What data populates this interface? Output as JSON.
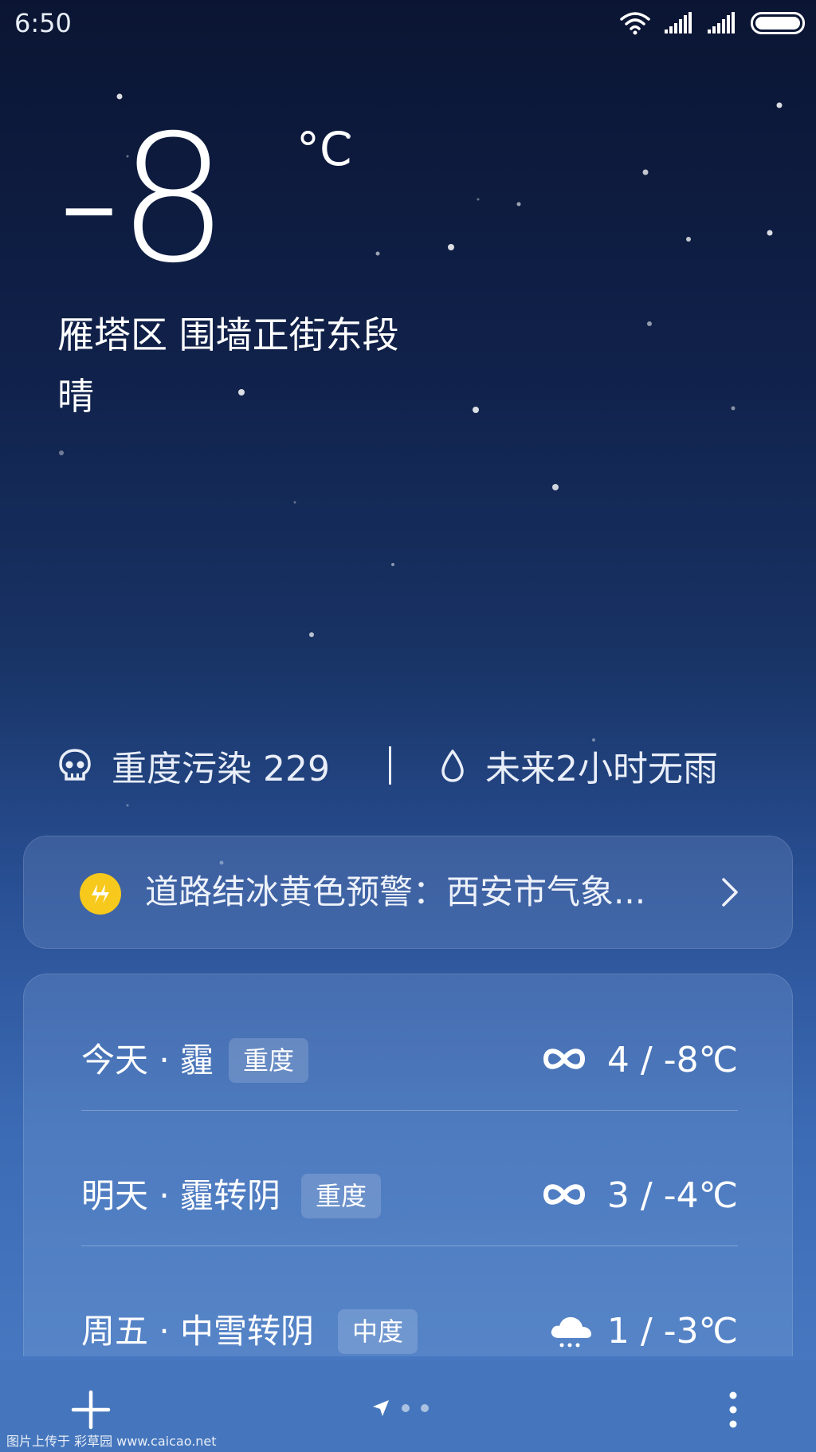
{
  "status_bar": {
    "time": "6:50",
    "icons": [
      "wifi-icon",
      "signal-icon",
      "signal-icon",
      "battery-icon"
    ]
  },
  "current": {
    "temperature": "-8",
    "unit": "°C",
    "location": "雁塔区  围墙正街东段",
    "condition": "晴"
  },
  "air_info": {
    "aqi_text": "重度污染 229",
    "aqi_icon": "skull-icon",
    "rain_text": "未来2小时无雨",
    "rain_icon": "droplet-icon"
  },
  "alert": {
    "text": "道路结冰黄色预警：西安市气象...",
    "icon": "warning-bolt-icon",
    "icon_color": "#f7c91c"
  },
  "forecast": [
    {
      "label": "今天 · 霾",
      "badge": "重度",
      "icon": "haze-icon",
      "range": "4 / -8℃"
    },
    {
      "label": "明天 · 霾转阴",
      "badge": "重度",
      "icon": "haze-icon",
      "range": "3 / -4℃"
    },
    {
      "label": "周五 · 中雪转阴",
      "badge": "中度",
      "icon": "snow-cloud-icon",
      "range": "1 / -3℃"
    }
  ],
  "bottom_bar": {
    "add_icon": "plus-icon",
    "location_icon": "location-arrow-icon",
    "more_icon": "more-vertical-icon"
  },
  "watermark": "图片上传于 彩草园 www.caicao.net",
  "colors": {
    "sky_top": "#0b1533",
    "sky_bottom": "#4a7cc4",
    "bottom_bar": "#4576bd"
  }
}
